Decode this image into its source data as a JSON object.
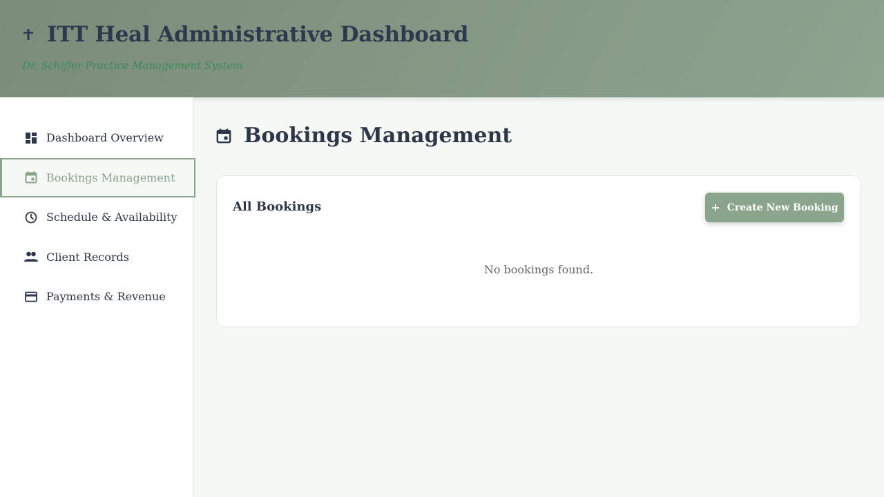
{
  "header": {
    "title": "ITT Heal Administrative Dashboard",
    "subtitle": "Dr. Schiffer Practice Management System",
    "icon": "cross-icon"
  },
  "sidebar": {
    "items": [
      {
        "label": "Dashboard Overview",
        "icon": "dashboard-icon",
        "active": false
      },
      {
        "label": "Bookings Management",
        "icon": "calendar-icon",
        "active": true
      },
      {
        "label": "Schedule & Availability",
        "icon": "clock-icon",
        "active": false
      },
      {
        "label": "Client Records",
        "icon": "people-icon",
        "active": false
      },
      {
        "label": "Payments & Revenue",
        "icon": "credit-card-icon",
        "active": false
      }
    ]
  },
  "main": {
    "title": "Bookings Management",
    "icon": "calendar-icon",
    "card": {
      "title": "All Bookings",
      "create_button": "Create New Booking",
      "empty_message": "No bookings found."
    }
  },
  "colors": {
    "accent": "#8aa58b",
    "header_start": "#7a8c7a",
    "header_end": "#8ea48f",
    "subtitle": "#3d8a5a",
    "text": "#2d3748",
    "background": "#f6f8f5"
  }
}
